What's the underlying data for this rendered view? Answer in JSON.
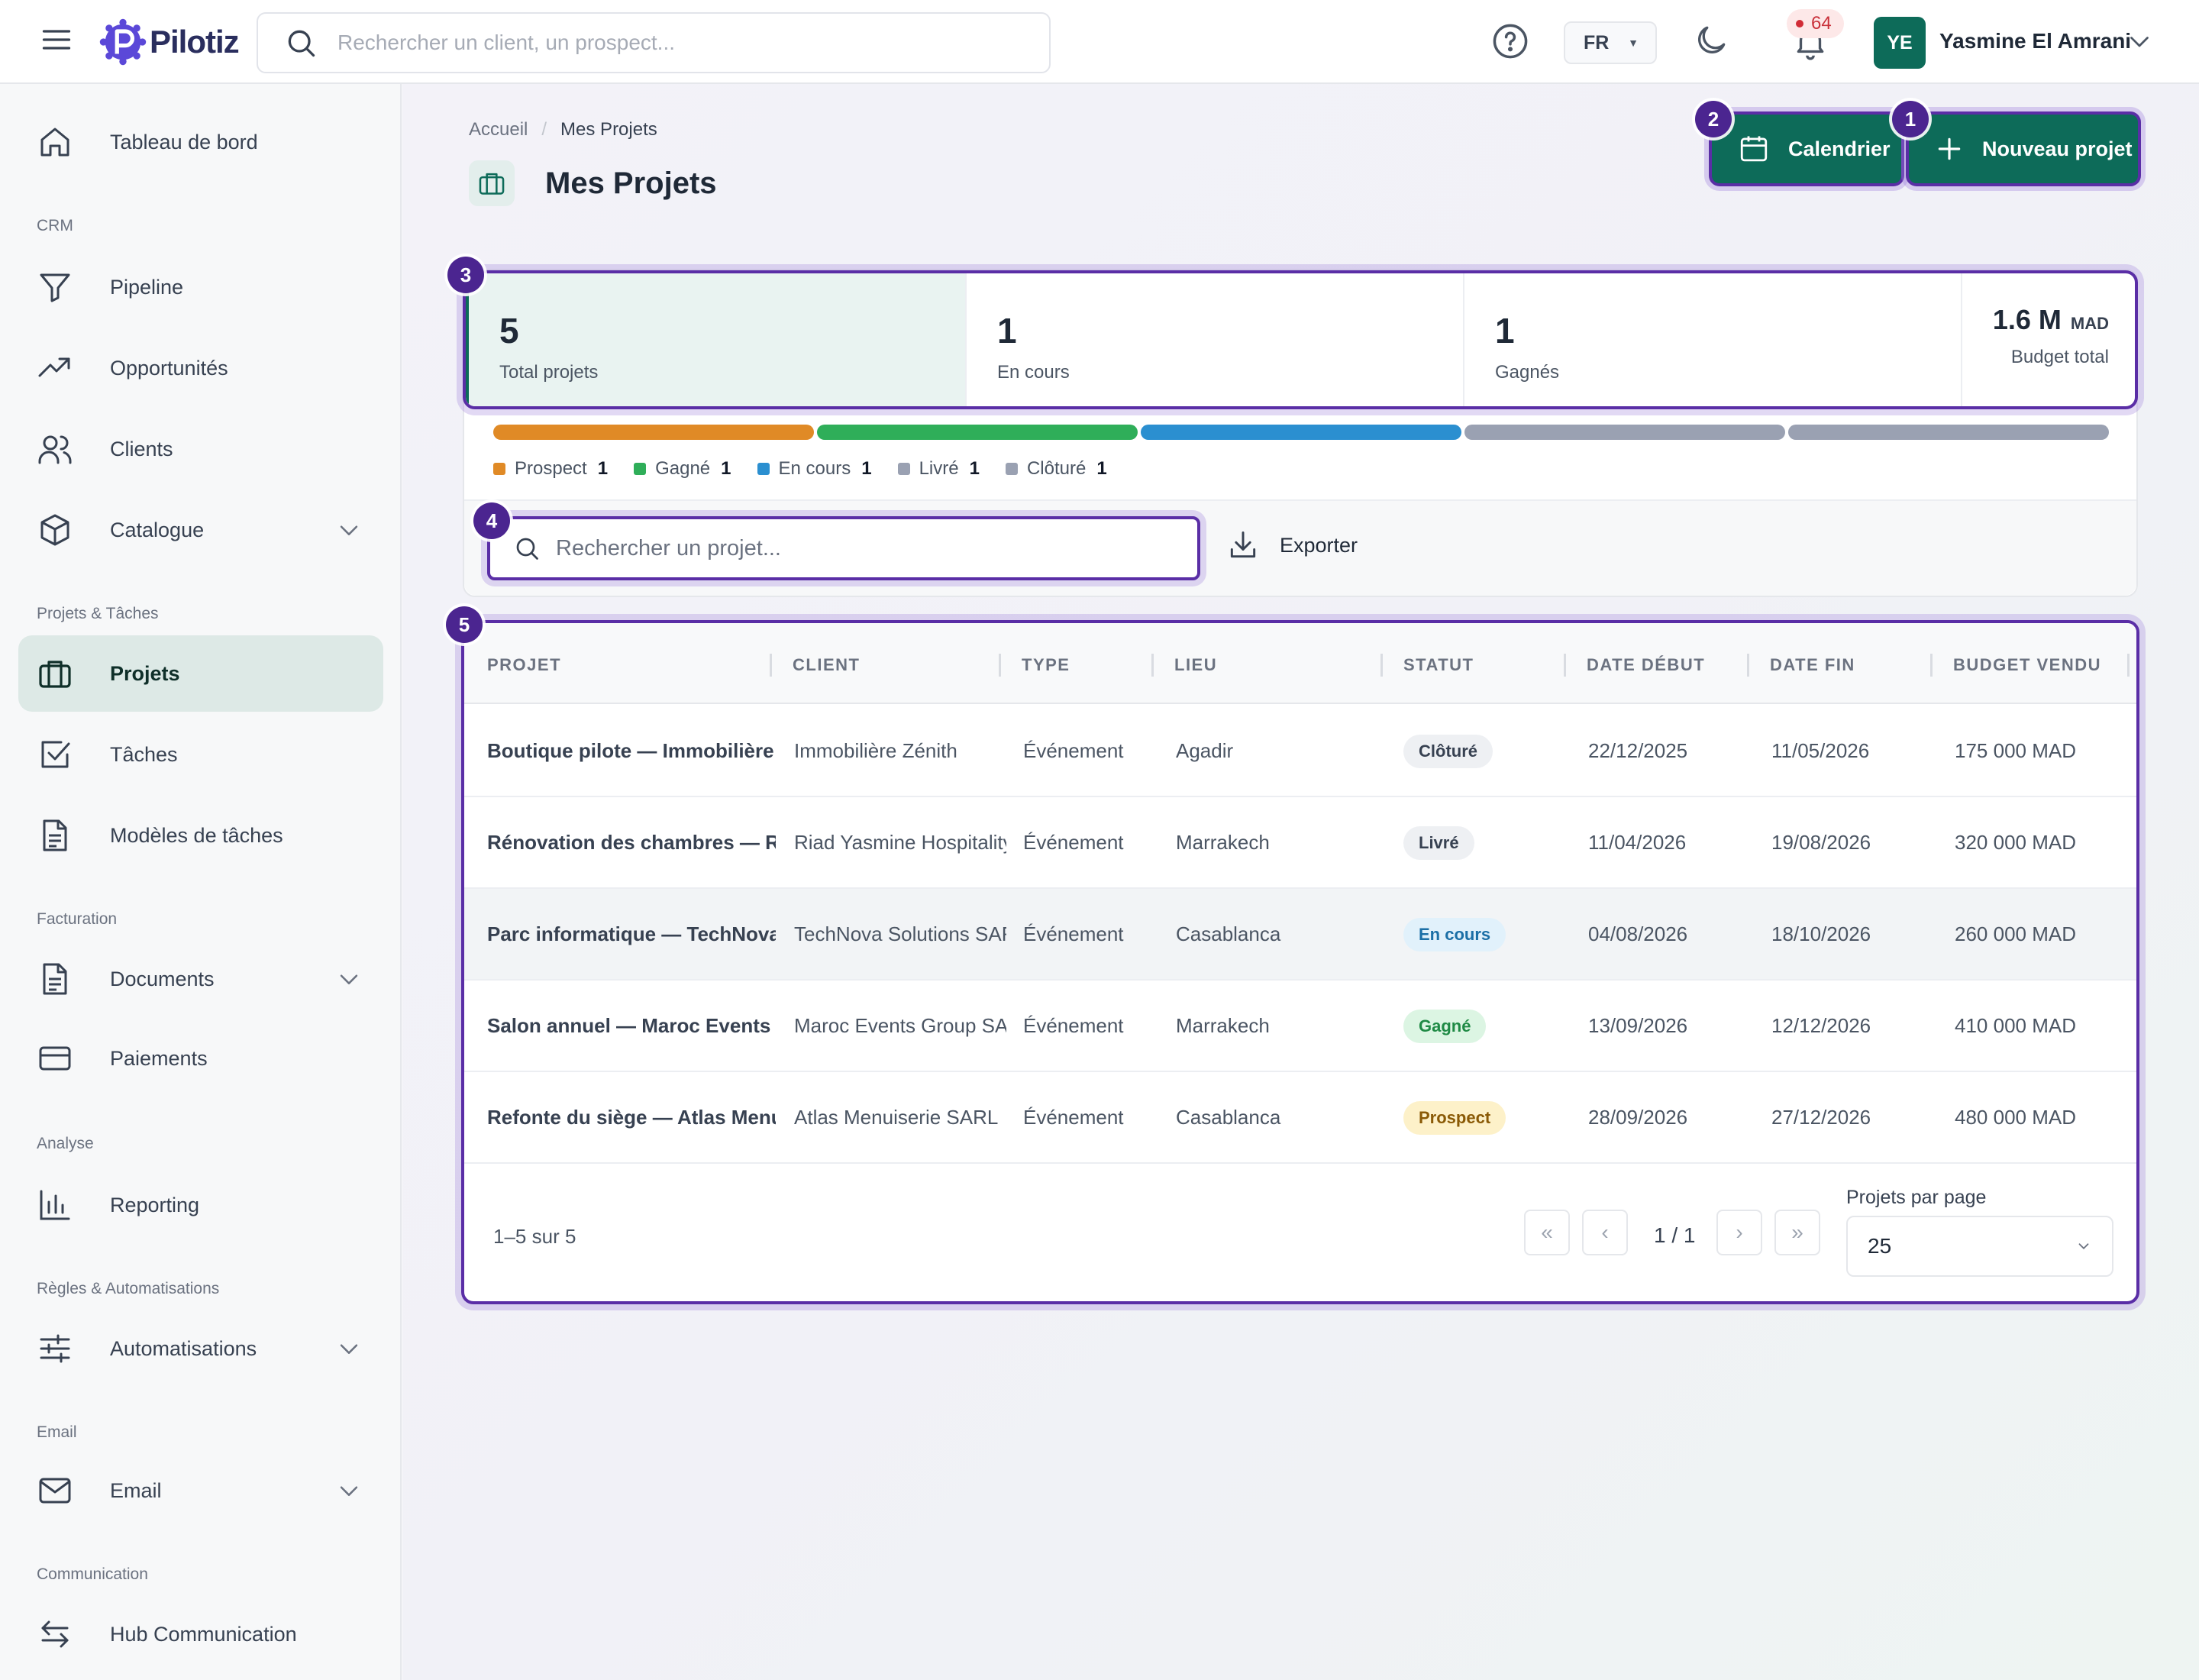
{
  "topbar": {
    "brand": "Pilotiz",
    "search_placeholder": "Rechercher un client, un prospect...",
    "language": "FR",
    "notifications_count": "64",
    "avatar_initials": "YE",
    "user_name": "Yasmine El Amrani"
  },
  "sidebar": {
    "dashboard": "Tableau de bord",
    "section_crm": "CRM",
    "pipeline": "Pipeline",
    "opportunities": "Opportunités",
    "clients": "Clients",
    "catalogue": "Catalogue",
    "section_projects": "Projets & Tâches",
    "projects": "Projets",
    "tasks": "Tâches",
    "task_templates": "Modèles de tâches",
    "section_billing": "Facturation",
    "documents": "Documents",
    "payments": "Paiements",
    "section_analysis": "Analyse",
    "reporting": "Reporting",
    "section_rules": "Règles & Automatisations",
    "automations": "Automatisations",
    "section_email": "Email",
    "email": "Email",
    "section_communication": "Communication",
    "hub": "Hub Communication"
  },
  "page": {
    "breadcrumb_home": "Accueil",
    "breadcrumb_current": "Mes Projets",
    "title": "Mes Projets",
    "calendar_button": "Calendrier",
    "new_project_button": "Nouveau projet",
    "tour_badges": [
      "1",
      "2",
      "3",
      "4",
      "5"
    ]
  },
  "stats": {
    "total_value": "5",
    "total_label": "Total projets",
    "in_progress_value": "1",
    "in_progress_label": "En cours",
    "won_value": "1",
    "won_label": "Gagnés",
    "budget_value": "1.6 M",
    "budget_unit": "MAD",
    "budget_label": "Budget total"
  },
  "status_bar": [
    {
      "label": "Prospect",
      "count": "1",
      "color": "#e08a26"
    },
    {
      "label": "Gagné",
      "count": "1",
      "color": "#2fae59"
    },
    {
      "label": "En cours",
      "count": "1",
      "color": "#2b8fd0"
    },
    {
      "label": "Livré",
      "count": "1",
      "color": "#9aa1b2"
    },
    {
      "label": "Clôturé",
      "count": "1",
      "color": "#9aa1b2"
    }
  ],
  "toolbar": {
    "search_placeholder": "Rechercher un projet...",
    "export_label": "Exporter"
  },
  "table": {
    "headers": [
      "PROJET",
      "CLIENT",
      "TYPE",
      "LIEU",
      "STATUT",
      "DATE DÉBUT",
      "DATE FIN",
      "BUDGET VENDU"
    ],
    "rows": [
      {
        "project": "Boutique pilote — Immobilière Zénith",
        "client": "Immobilière Zénith",
        "type": "Événement",
        "place": "Agadir",
        "status": "Clôturé",
        "start": "22/12/2025",
        "end": "11/05/2026",
        "budget": "175 000 MAD"
      },
      {
        "project": "Rénovation des chambres — Riad Yasmine",
        "client": "Riad Yasmine Hospitality",
        "type": "Événement",
        "place": "Marrakech",
        "status": "Livré",
        "start": "11/04/2026",
        "end": "19/08/2026",
        "budget": "320 000 MAD"
      },
      {
        "project": "Parc informatique — TechNova",
        "client": "TechNova Solutions SARL",
        "type": "Événement",
        "place": "Casablanca",
        "status": "En cours",
        "start": "04/08/2026",
        "end": "18/10/2026",
        "budget": "260 000 MAD"
      },
      {
        "project": "Salon annuel — Maroc Events Group",
        "client": "Maroc Events Group SA",
        "type": "Événement",
        "place": "Marrakech",
        "status": "Gagné",
        "start": "13/09/2026",
        "end": "12/12/2026",
        "budget": "410 000 MAD"
      },
      {
        "project": "Refonte du siège — Atlas Menuiserie",
        "client": "Atlas Menuiserie SARL",
        "type": "Événement",
        "place": "Casablanca",
        "status": "Prospect",
        "start": "28/09/2026",
        "end": "27/12/2026",
        "budget": "480 000 MAD"
      }
    ]
  },
  "pagination": {
    "range": "1–5 sur 5",
    "page": "1 / 1",
    "per_page_label": "Projets par page",
    "per_page_value": "25"
  }
}
